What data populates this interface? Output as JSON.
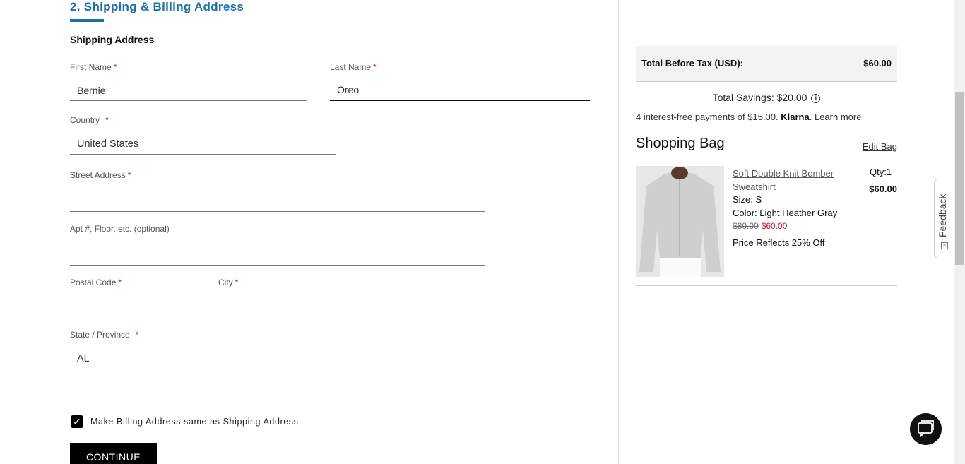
{
  "checkout": {
    "section_title": "2. Shipping & Billing Address",
    "shipping_heading": "Shipping Address",
    "required_mark": "*",
    "first_name": {
      "label": "First Name",
      "value": "Bernie"
    },
    "last_name": {
      "label": "Last Name",
      "value": "Oreo"
    },
    "country": {
      "label": "Country",
      "value": "United States"
    },
    "street": {
      "label": "Street Address",
      "value": ""
    },
    "apt": {
      "label": "Apt #, Floor, etc. (optional)",
      "value": ""
    },
    "postal": {
      "label": "Postal Code",
      "value": ""
    },
    "city": {
      "label": "City",
      "value": ""
    },
    "state": {
      "label": "State / Province",
      "value": "AL"
    },
    "billing_same_label": "Make Billing Address same as Shipping Address",
    "billing_same_checked": true,
    "checkmark": "✓",
    "continue_label": "CONTINUE"
  },
  "summary": {
    "total_label": "Total Before Tax (USD):",
    "total_value": "$60.00",
    "savings": "Total Savings: $20.00",
    "info_glyph": "i",
    "klarna_prefix": "4 interest-free payments of $15.00. ",
    "klarna_brand": "Klarna",
    "klarna_dot": ".",
    "klarna_link": "Learn more",
    "bag_title": "Shopping Bag",
    "edit_bag": "Edit Bag",
    "item": {
      "name": "Soft Double Knit Bomber Sweatshirt",
      "size": "Size: S",
      "color": "Color: Light Heather Gray",
      "price_old": "$80.00",
      "price_new": "$60.00",
      "promo": "Price Reflects 25% Off",
      "qty": "Qty:1",
      "line_price": "$60.00"
    }
  },
  "feedback": {
    "label": "Feedback"
  },
  "colors": {
    "accent": "#1d6fa5",
    "sale": "#c8102e",
    "button": "#000000"
  },
  "icons": {
    "chat": "chat-icon",
    "info": "info-icon",
    "feedback": "feedback-icon",
    "check": "checkmark-icon"
  }
}
